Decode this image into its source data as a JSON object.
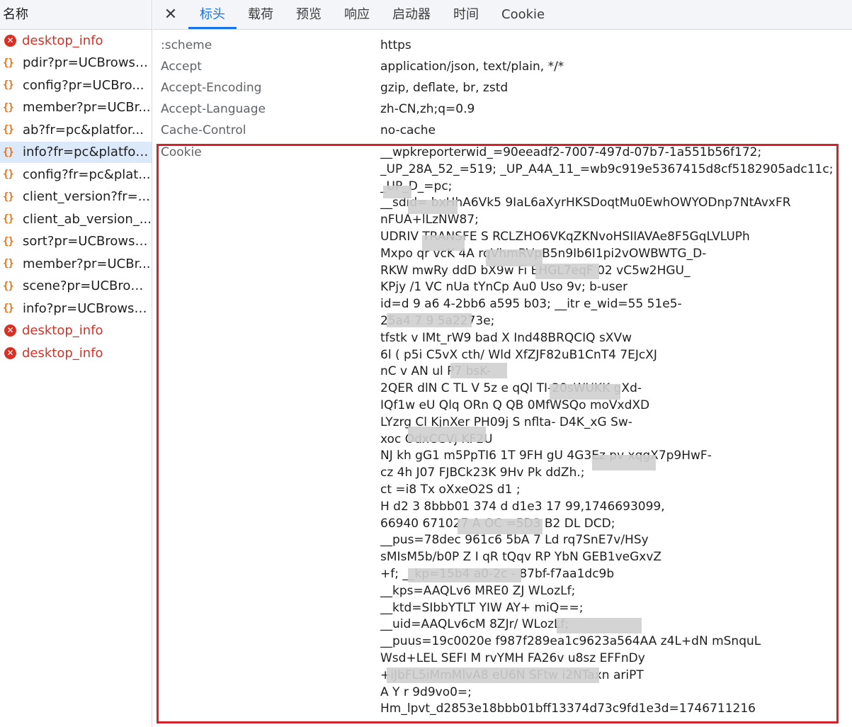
{
  "left_panel": {
    "header": "名称",
    "items": [
      {
        "label": "desktop_info",
        "type": "error"
      },
      {
        "label": "pdir?pr=UCBrowse...",
        "type": "xhr"
      },
      {
        "label": "config?pr=UCBro...",
        "type": "xhr"
      },
      {
        "label": "member?pr=UCBr...",
        "type": "xhr"
      },
      {
        "label": "ab?fr=pc&platfor...",
        "type": "xhr"
      },
      {
        "label": "info?fr=pc&platfor...",
        "type": "xhr",
        "selected": true
      },
      {
        "label": "config?fr=pc&plat...",
        "type": "xhr"
      },
      {
        "label": "client_version?fr=...",
        "type": "xhr"
      },
      {
        "label": "client_ab_version_...",
        "type": "xhr"
      },
      {
        "label": "sort?pr=UCBrowse...",
        "type": "xhr"
      },
      {
        "label": "member?pr=UCBr...",
        "type": "xhr"
      },
      {
        "label": "scene?pr=UCBrow...",
        "type": "xhr"
      },
      {
        "label": "info?pr=UCBrowse...",
        "type": "xhr"
      },
      {
        "label": "desktop_info",
        "type": "error"
      },
      {
        "label": "desktop_info",
        "type": "error"
      }
    ]
  },
  "tabs": {
    "close": "✕",
    "items": [
      "标头",
      "载荷",
      "预览",
      "响应",
      "启动器",
      "时间",
      "Cookie"
    ],
    "active": "标头"
  },
  "headers": [
    {
      "name": ":scheme",
      "value": "https"
    },
    {
      "name": "Accept",
      "value": "application/json, text/plain, */*"
    },
    {
      "name": "Accept-Encoding",
      "value": "gzip, deflate, br, zstd"
    },
    {
      "name": "Accept-Language",
      "value": "zh-CN,zh;q=0.9"
    },
    {
      "name": "Cache-Control",
      "value": "no-cache"
    }
  ],
  "cookie": {
    "name": "Cookie",
    "lines": [
      "__wpkreporterwid_=90eeadf2-7007-497d-07b7-1a551b56f172;",
      "_UP_28A_52_=519; _UP_A4A_11_=wb9c919e5367415d8cf5182905adc11c;",
      "_UP_D_=pc;",
      "__sdid=      bxHhA6Vk5 9IaL6aXyrHKSDoqtMu0EwhOWYODnp7NtAvxFR",
      "nFUA+lLzNW87;",
      "UDRIV  TRANSFE  S        RCLZHO6VKqZKNvoHSIIAVAe8F5GqLVLUPh",
      "Mxpo  qr   vcK         4A    rqVhmRVpB5n9Ib6I1pi2vOWBWTG_D-",
      "RKW   mwRy    ddD   bX9w        Fi EHGL7eqF        02    vC5w2HGU_",
      "KPjy   /1   VC  nUa    tYnCp   Au0    Uso     9v; b-user",
      "id=d  9       a6     4-2bb6   a595       b03; __itr  e_wid=55    51e5-",
      "25a4        7     9   5a2273e;",
      "tfstk       v          IMt_rW9    bad   X    Ind48BRQCIQ   sXVw",
      "6l     (    p5i    C5vX   cth/  Wld    XfZJF82uB1CnT4   7EJcXJ",
      "nC      v   AN   ul    P7    bsK-",
      "2QER       dlN    C   TL   V   5z     e   qQl     TI-20sWUKK   gXd-",
      "IQf1w    eU   Qlq      ORn      Q     QB   0MfWSQo   moVxdXD",
      "LYzrg      Cl    KjnXer    PH09j    S       nflta-     D4K_xG   Sw-",
      "xoc            OdxCCVj      KF2U",
      "NJ     kh   gG1   m5PpTI6    1T  9FH    gU   4G3Ez    pv   xqgX7p9HwF-",
      "cz      4h   J07  FJBCk23K     9Hv   Pk    ddZh.;",
      "ct      =i8   Tx   oXxeO2S    d1     ;",
      "H        d2     3   8bbb01       374     d   d1e3      17       99,1746693099,",
      "      66940       671027        A    OC     =5D3    B2  DL   DCD;",
      "__pus=78dec      961c6     5bA    7    Ld     rq7SnE7v/HSy",
      "sMIsM5b/b0P        Z      I    qR    tQqv    RP     YbN     GEB1veGxvZ",
      "+f; __kp=15b4   a0-2c    -     87bf-f7aa1dc9b",
      "__kps=AAQLv6   MRE0    ZJ    WLozLf;",
      "__ktd=SIbbYTLT     YIW     AY+   miQ==;",
      "__uid=AAQLv6cM      8ZJr/ WLozLf;",
      "__puus=19c0020e      f987f289ea1c9623a564AA    z4L+dN       mSnquL",
      "Wsd+LEL          SEFI      M     rvYMH     FA26v    u8sz     EFFnDy",
      "+iJbFL5iMmMlvA8             eU6N    SFtw     i2NTaxn     ariPT",
      "                      A    Y                 r    9d9vo0=;",
      "Hm_lpvt_d2853e18bbb01bff13374d73c9fd1e3d=1746711216"
    ]
  }
}
